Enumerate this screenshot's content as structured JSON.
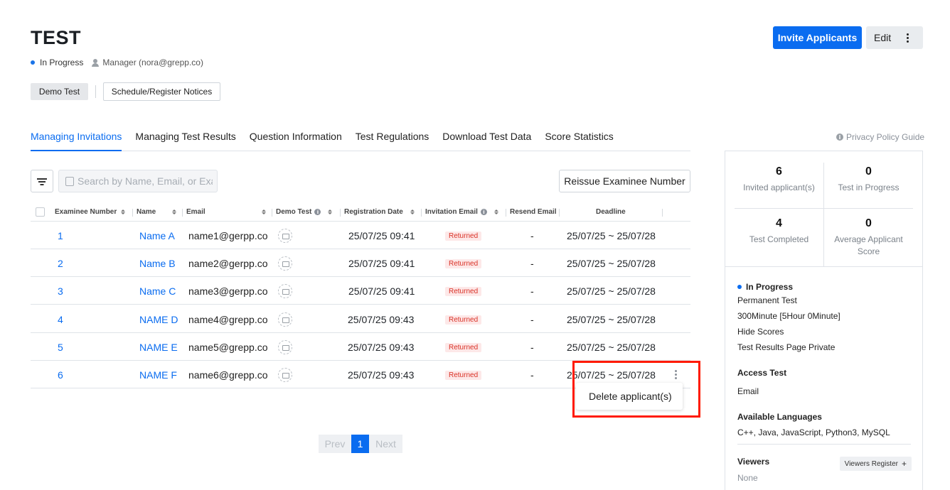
{
  "header": {
    "title": "TEST",
    "status": "In Progress",
    "manager": "Manager (nora@grepp.co)",
    "invite_label": "Invite Applicants",
    "edit_label": "Edit"
  },
  "chips": {
    "demo": "Demo Test",
    "notice": "Schedule/Register Notices"
  },
  "tabs": [
    {
      "label": "Managing Invitations",
      "active": true
    },
    {
      "label": "Managing Test Results"
    },
    {
      "label": "Question Information"
    },
    {
      "label": "Test Regulations"
    },
    {
      "label": "Download Test Data"
    },
    {
      "label": "Score Statistics"
    }
  ],
  "privacy_label": "Privacy Policy Guide",
  "search": {
    "placeholder": "Search by Name, Email, or Exam"
  },
  "reissue_label": "Reissue Examinee Number",
  "table": {
    "columns": {
      "number": "Examinee Number",
      "name": "Name",
      "email": "Email",
      "demo": "Demo Test",
      "reg_date": "Registration Date",
      "invite_email": "Invitation Email",
      "resend": "Resend Email",
      "deadline": "Deadline"
    },
    "rows": [
      {
        "num": "1",
        "name": "Name A",
        "email": "name1@gerpp.co",
        "date": "25/07/25 09:41",
        "status": "Returned",
        "resend": "-",
        "deadline": "25/07/25 ~ 25/07/28"
      },
      {
        "num": "2",
        "name": "Name B",
        "email": "name2@gerpp.co",
        "date": "25/07/25 09:41",
        "status": "Returned",
        "resend": "-",
        "deadline": "25/07/25 ~ 25/07/28"
      },
      {
        "num": "3",
        "name": "Name C",
        "email": "name3@gerpp.co",
        "date": "25/07/25 09:41",
        "status": "Returned",
        "resend": "-",
        "deadline": "25/07/25 ~ 25/07/28"
      },
      {
        "num": "4",
        "name": "NAME D",
        "email": "name4@grepp.co",
        "date": "25/07/25 09:43",
        "status": "Returned",
        "resend": "-",
        "deadline": "25/07/25 ~ 25/07/28"
      },
      {
        "num": "5",
        "name": "NAME E",
        "email": "name5@grepp.co",
        "date": "25/07/25 09:43",
        "status": "Returned",
        "resend": "-",
        "deadline": "25/07/25 ~ 25/07/28"
      },
      {
        "num": "6",
        "name": "NAME F",
        "email": "name6@grepp.co",
        "date": "25/07/25 09:43",
        "status": "Returned",
        "resend": "-",
        "deadline": "25/07/25 ~ 25/07/28"
      }
    ]
  },
  "context_menu": {
    "delete_label": "Delete applicant(s)"
  },
  "pager": {
    "prev": "Prev",
    "current": "1",
    "next": "Next"
  },
  "sidebar": {
    "stats": [
      {
        "value": "6",
        "label": "Invited applicant(s)"
      },
      {
        "value": "0",
        "label": "Test in Progress"
      },
      {
        "value": "4",
        "label": "Test Completed"
      },
      {
        "value": "0",
        "label": "Average Applicant Score"
      }
    ],
    "status": "In Progress",
    "details": [
      "Permanent Test",
      "300Minute [5Hour 0Minute]",
      "Hide Scores",
      "Test Results Page Private"
    ],
    "access_title": "Access Test",
    "access_value": "Email",
    "lang_title": "Available Languages",
    "lang_value": "C++, Java, JavaScript, Python3, MySQL",
    "viewers_title": "Viewers",
    "viewers_btn": "Viewers Register",
    "viewers_value": "None"
  },
  "colors": {
    "accent": "#0a6cf0",
    "danger": "#d93025",
    "highlight": "#ff1a00"
  }
}
